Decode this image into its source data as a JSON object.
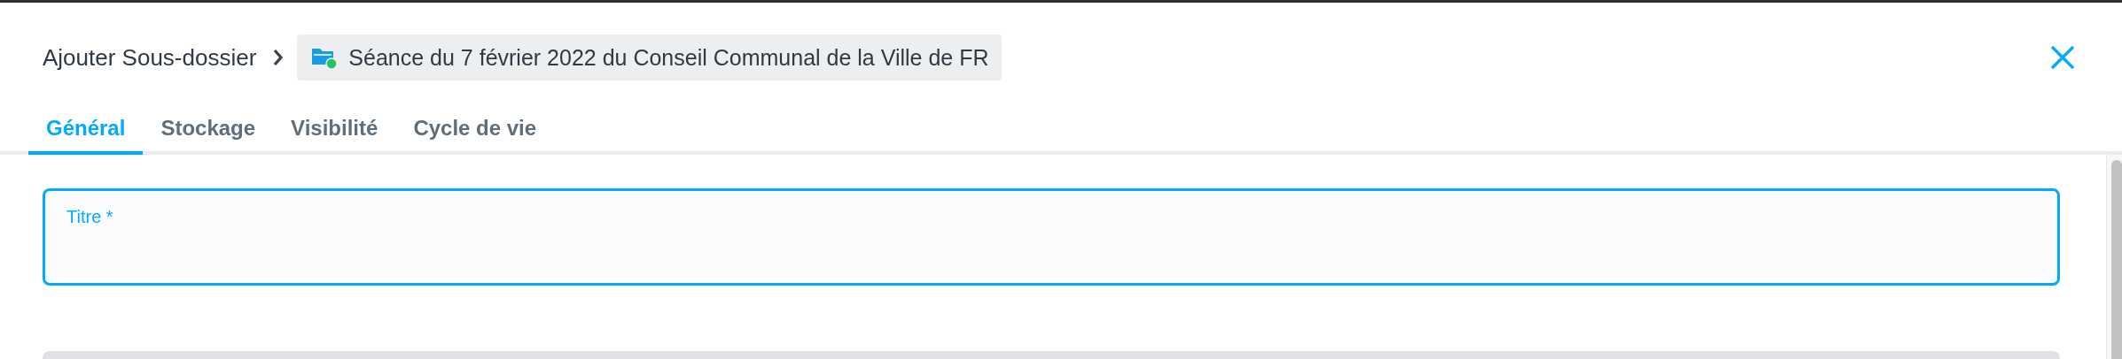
{
  "dialog": {
    "title": "Ajouter Sous-dossier",
    "breadcrumb": "Séance du 7 février 2022 du Conseil Communal de la Ville de FR"
  },
  "tabs": [
    {
      "label": "Général",
      "selected": true
    },
    {
      "label": "Stockage",
      "selected": false
    },
    {
      "label": "Visibilité",
      "selected": false
    },
    {
      "label": "Cycle de vie",
      "selected": false
    }
  ],
  "form": {
    "fields": [
      {
        "label": "Titre *",
        "focused": true
      }
    ]
  }
}
